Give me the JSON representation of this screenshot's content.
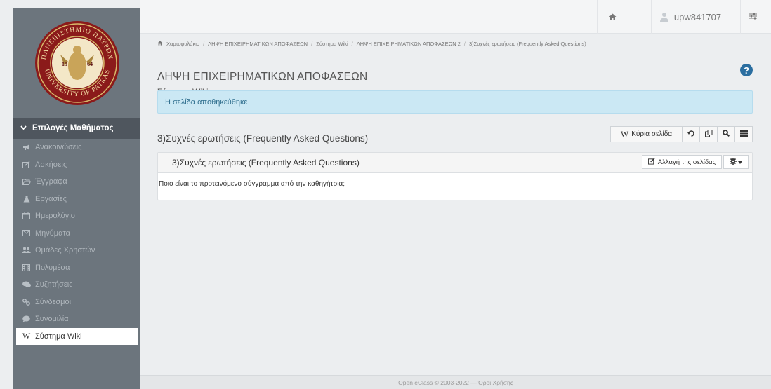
{
  "sidebar": {
    "logo_top_text": "ΠΑΝΕΠΙΣΤΗΜΙΟ ΠΑΤΡΩΝ",
    "logo_bottom_text": "UNIVERSITY OF PATRAS",
    "logo_left": "19",
    "logo_right": "64",
    "menu_title": "Επιλογές Μαθήματος",
    "items": [
      {
        "label": "Ανακοινώσεις",
        "icon": "megaphone-icon"
      },
      {
        "label": "Ασκήσεις",
        "icon": "edit-icon"
      },
      {
        "label": "Έγγραφα",
        "icon": "folder-icon"
      },
      {
        "label": "Εργασίες",
        "icon": "flask-icon"
      },
      {
        "label": "Ημερολόγιο",
        "icon": "calendar-icon"
      },
      {
        "label": "Μηνύματα",
        "icon": "envelope-icon"
      },
      {
        "label": "Ομάδες Χρηστών",
        "icon": "users-icon"
      },
      {
        "label": "Πολυμέσα",
        "icon": "film-icon"
      },
      {
        "label": "Συζητήσεις",
        "icon": "comments-icon"
      },
      {
        "label": "Σύνδεσμοι",
        "icon": "link-icon"
      },
      {
        "label": "Συνομιλία",
        "icon": "chat-icon"
      },
      {
        "label": "Σύστημα Wiki",
        "icon": "wikipedia-icon",
        "active": true
      }
    ]
  },
  "topbar": {
    "username": "upw841707"
  },
  "breadcrumb": [
    "Χαρτοφυλάκιο",
    "ΛΗΨΗ ΕΠΙΧΕΙΡΗΜΑΤΙΚΩΝ ΑΠΟΦΑΣΕΩΝ",
    "Σύστημα Wiki",
    "ΛΗΨΗ ΕΠΙΧΕΙΡΗΜΑΤΙΚΩΝ ΑΠΟΦΑΣΕΩΝ 2",
    "3)Συχνές ερωτήσεις (Frequently Asked Questions)"
  ],
  "header": {
    "title": "ΛΗΨΗ ΕΠΙΧΕΙΡΗΜΑΤΙΚΩΝ ΑΠΟΦΑΣΕΩΝ",
    "subtitle": "Σύστημα Wiki"
  },
  "alert": {
    "text": "Η σελίδα αποθηκεύθηκε"
  },
  "wiki": {
    "section_title": "3)Συχνές ερωτήσεις (Frequently Asked Questions)",
    "main_page_label": "Κύρια σελίδα",
    "panel_title": "3)Συχνές ερωτήσεις (Frequently Asked Questions)",
    "edit_label": "Αλλαγή της σελίδας",
    "content": "Ποιο είναι το προτεινόμενο σύγγραμμα από την καθηγήτρια;"
  },
  "footer": {
    "text": "Open eClass © 2003-2022 — Όροι Χρήσης"
  },
  "colors": {
    "sidebar": "#6c757d",
    "sidebar_header": "#4f565e",
    "alert_bg": "#cbe8f4",
    "alert_text": "#31708f",
    "help": "#2b6ea0"
  }
}
